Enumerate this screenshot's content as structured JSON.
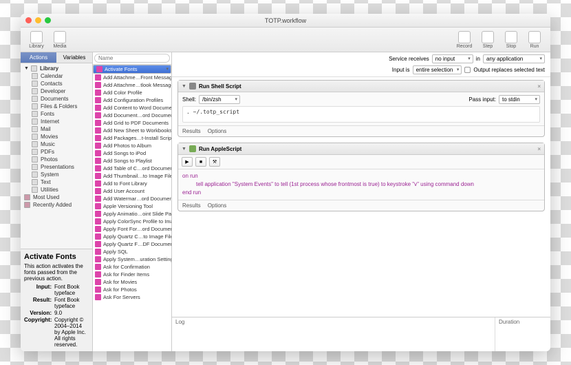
{
  "window": {
    "title": "TOTP.workflow"
  },
  "toolbar": {
    "left": [
      {
        "name": "library-button",
        "label": "Library"
      },
      {
        "name": "media-button",
        "label": "Media"
      }
    ],
    "right": [
      {
        "name": "record-button",
        "label": "Record"
      },
      {
        "name": "step-button",
        "label": "Step"
      },
      {
        "name": "stop-button",
        "label": "Stop"
      },
      {
        "name": "run-button",
        "label": "Run"
      }
    ]
  },
  "tabs": {
    "actions": "Actions",
    "variables": "Variables"
  },
  "library": {
    "header": "Library",
    "items": [
      "Calendar",
      "Contacts",
      "Developer",
      "Documents",
      "Files & Folders",
      "Fonts",
      "Internet",
      "Mail",
      "Movies",
      "Music",
      "PDFs",
      "Photos",
      "Presentations",
      "System",
      "Text",
      "Utilities"
    ],
    "extras": [
      "Most Used",
      "Recently Added"
    ]
  },
  "search": {
    "placeholder": "Name"
  },
  "actionsList": [
    "Activate Fonts",
    "Add Attachme…Front Message",
    "Add Attachme…tlook Messages",
    "Add Color Profile",
    "Add Configuration Profiles",
    "Add Content to Word Documents",
    "Add Document…ord Documents",
    "Add Grid to PDF Documents",
    "Add New Sheet to Workbooks",
    "Add Packages…t-Install Scripts",
    "Add Photos to Album",
    "Add Songs to iPod",
    "Add Songs to Playlist",
    "Add Table of C…ord Documents",
    "Add Thumbnail…to Image Files",
    "Add to Font Library",
    "Add User Account",
    "Add Watermar…ord Documents",
    "Apple Versioning Tool",
    "Apply Animatio…oint Slide Parts",
    "Apply ColorSync Profile to Images",
    "Apply Font For…ord Documents",
    "Apply Quartz C…to Image Files",
    "Apply Quartz F…DF Documents",
    "Apply SQL",
    "Apply System…uration Settings",
    "Ask for Confirmation",
    "Ask for Finder Items",
    "Ask for Movies",
    "Ask for Photos",
    "Ask For Servers"
  ],
  "info": {
    "title": "Activate Fonts",
    "desc": "This action activates the fonts passed from the previous action.",
    "input_k": "Input:",
    "input_v": "Font Book typeface",
    "result_k": "Result:",
    "result_v": "Font Book typeface",
    "version_k": "Version:",
    "version_v": "9.0",
    "copyright_k": "Copyright:",
    "copyright_v": "Copyright © 2004–2014 by Apple Inc. All rights reserved."
  },
  "config": {
    "receives_label": "Service receives",
    "receives_value": "no input",
    "in_label": "in",
    "in_value": "any application",
    "inputis_label": "Input is",
    "inputis_value": "entire selection",
    "replace_label": "Output replaces selected text"
  },
  "shell": {
    "title": "Run Shell Script",
    "shell_label": "Shell:",
    "shell_value": "/bin/zsh",
    "pass_label": "Pass input:",
    "pass_value": "to stdin",
    "code": ". ~/.totp_script",
    "results": "Results",
    "options": "Options"
  },
  "applescript": {
    "title": "Run AppleScript",
    "line1": "on run",
    "line2": "tell application \"System Events\" to tell (1st process whose frontmost is true) to keystroke \"v\" using command down",
    "line3": "end run",
    "results": "Results",
    "options": "Options"
  },
  "log": {
    "log_label": "Log",
    "duration_label": "Duration"
  }
}
